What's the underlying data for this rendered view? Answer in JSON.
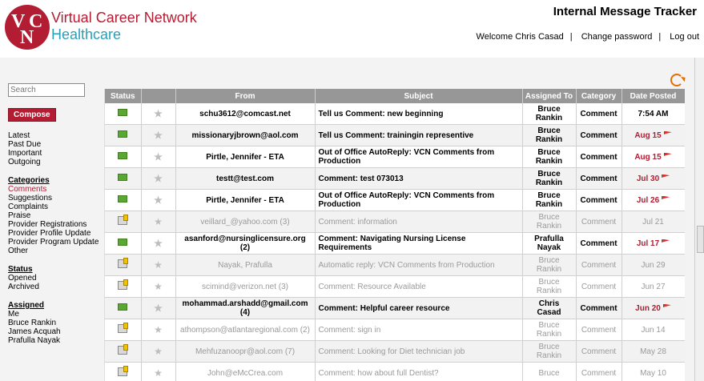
{
  "brand": {
    "line1": "Virtual Career Network",
    "line2": "Healthcare",
    "logo_letters": [
      "V",
      "C",
      "N"
    ]
  },
  "header": {
    "title": "Internal Message Tracker",
    "welcome": "Welcome Chris Casad",
    "change_password": "Change password",
    "logout": "Log out"
  },
  "search": {
    "placeholder": "Search"
  },
  "compose_label": "Compose",
  "folders": [
    "Latest",
    "Past Due",
    "Important",
    "Outgoing"
  ],
  "categories": {
    "heading": "Categories",
    "items": [
      "Comments",
      "Suggestions",
      "Complaints",
      "Praise",
      "Provider Registrations",
      "Provider Profile Update",
      "Provider Program Update",
      "Other"
    ]
  },
  "status": {
    "heading": "Status",
    "items": [
      "Opened",
      "Archived"
    ]
  },
  "assigned": {
    "heading": "Assigned",
    "items": [
      "Me",
      "Bruce Rankin",
      "James Acquah",
      "Prafulla Nayak"
    ]
  },
  "table": {
    "columns": [
      "Status",
      "",
      "From",
      "Subject",
      "Assigned To",
      "Category",
      "Date Posted"
    ],
    "rows": [
      {
        "from": "schu3612@comcast.net",
        "subject": "Tell us Comment: new beginning",
        "assigned": "Bruce Rankin",
        "category": "Comment",
        "date": "7:54 AM",
        "unread": true,
        "flag": false,
        "date_red": false
      },
      {
        "from": "missionaryjbrown@aol.com",
        "subject": "Tell us Comment: trainingin representive",
        "assigned": "Bruce Rankin",
        "category": "Comment",
        "date": "Aug 15",
        "unread": true,
        "flag": true,
        "date_red": true
      },
      {
        "from": "Pirtle, Jennifer - ETA",
        "subject": "Out of Office AutoReply: VCN Comments from Production",
        "assigned": "Bruce Rankin",
        "category": "Comment",
        "date": "Aug 15",
        "unread": true,
        "flag": true,
        "date_red": true
      },
      {
        "from": "testt@test.com",
        "subject": "Comment: test 073013",
        "assigned": "Bruce Rankin",
        "category": "Comment",
        "date": "Jul 30",
        "unread": true,
        "flag": true,
        "date_red": true
      },
      {
        "from": "Pirtle, Jennifer - ETA",
        "subject": "Out of Office AutoReply: VCN Comments from Production",
        "assigned": "Bruce Rankin",
        "category": "Comment",
        "date": "Jul 26",
        "unread": true,
        "flag": true,
        "date_red": true
      },
      {
        "from": "veillard_@yahoo.com (3)",
        "subject": "Comment: information",
        "assigned": "Bruce Rankin",
        "category": "Comment",
        "date": "Jul 21",
        "unread": false,
        "flag": false,
        "date_red": false
      },
      {
        "from": "asanford@nursinglicensure.org (2)",
        "subject": "Comment: Navigating Nursing License Requirements",
        "assigned": "Prafulla Nayak",
        "category": "Comment",
        "date": "Jul 17",
        "unread": true,
        "flag": true,
        "date_red": true
      },
      {
        "from": "Nayak, Prafulla",
        "subject": "Automatic reply: VCN Comments from Production",
        "assigned": "Bruce Rankin",
        "category": "Comment",
        "date": "Jun 29",
        "unread": false,
        "flag": false,
        "date_red": false
      },
      {
        "from": "scimind@verizon.net (3)",
        "subject": "Comment: Resource Available",
        "assigned": "Bruce Rankin",
        "category": "Comment",
        "date": "Jun 27",
        "unread": false,
        "flag": false,
        "date_red": false
      },
      {
        "from": "mohammad.arshadd@gmail.com (4)",
        "subject": "Comment: Helpful career resource",
        "assigned": "Chris Casad",
        "category": "Comment",
        "date": "Jun 20",
        "unread": true,
        "flag": true,
        "date_red": true
      },
      {
        "from": "athompson@atlantaregional.com (2)",
        "subject": "Comment: sign in",
        "assigned": "Bruce Rankin",
        "category": "Comment",
        "date": "Jun 14",
        "unread": false,
        "flag": false,
        "date_red": false
      },
      {
        "from": "Mehfuzanoopr@aol.com (7)",
        "subject": "Comment: Looking for Diet technician job",
        "assigned": "Bruce Rankin",
        "category": "Comment",
        "date": "May 28",
        "unread": false,
        "flag": false,
        "date_red": false
      },
      {
        "from": "John@eMcCrea.com",
        "subject": "Comment: how about full Dentist?",
        "assigned": "Bruce",
        "category": "Comment",
        "date": "May 10",
        "unread": false,
        "flag": false,
        "date_red": false
      }
    ]
  }
}
